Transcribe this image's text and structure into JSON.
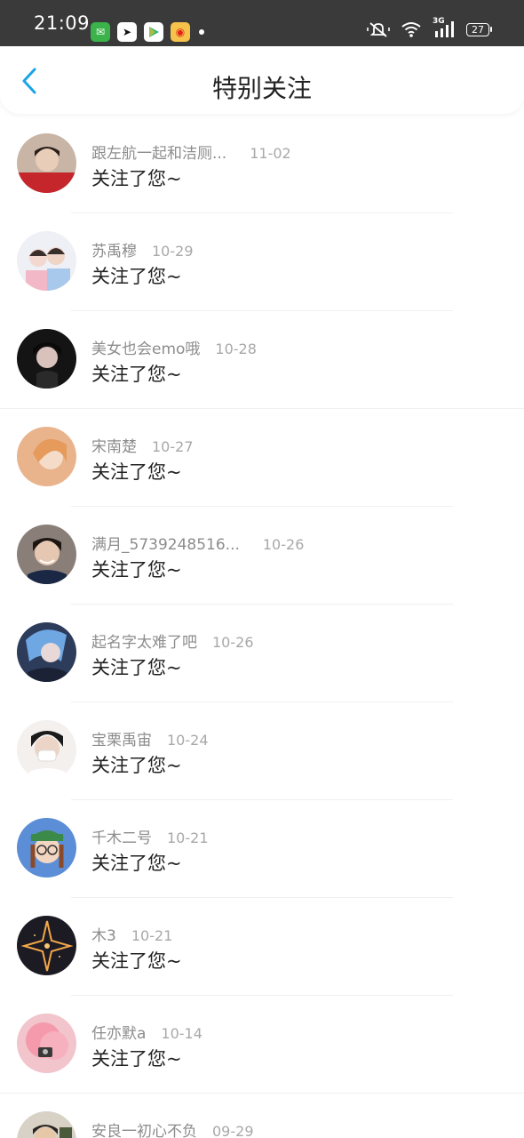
{
  "status_bar": {
    "time": "21:09",
    "network": "3G",
    "battery": "27"
  },
  "header": {
    "title": "特别关注"
  },
  "colors": {
    "accent": "#1ba3e8",
    "status_bar_bg": "#3a3a3a"
  },
  "items": [
    {
      "name": "跟左航一起和洁厕...",
      "date": "11-02",
      "message": "关注了您~"
    },
    {
      "name": "苏禹穆",
      "date": "10-29",
      "message": "关注了您~"
    },
    {
      "name": "美女也会emo哦",
      "date": "10-28",
      "message": "关注了您~"
    },
    {
      "name": "宋南楚",
      "date": "10-27",
      "message": "关注了您~"
    },
    {
      "name": "满月_5739248516...",
      "date": "10-26",
      "message": "关注了您~"
    },
    {
      "name": "起名字太难了吧",
      "date": "10-26",
      "message": "关注了您~"
    },
    {
      "name": "宝栗禹宙",
      "date": "10-24",
      "message": "关注了您~"
    },
    {
      "name": "千木二号",
      "date": "10-21",
      "message": "关注了您~"
    },
    {
      "name": "木3",
      "date": "10-21",
      "message": "关注了您~"
    },
    {
      "name": "任亦默a",
      "date": "10-14",
      "message": "关注了您~"
    },
    {
      "name": "安良一初心不负",
      "date": "09-29",
      "message": ""
    }
  ]
}
